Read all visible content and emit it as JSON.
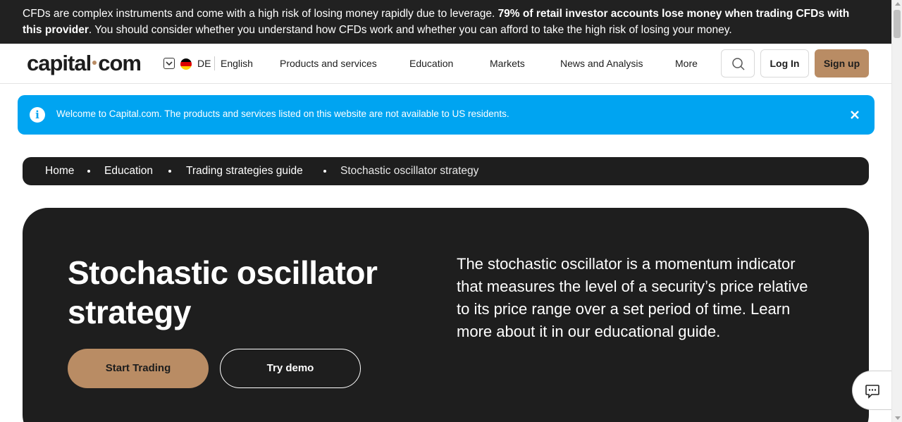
{
  "risk_warning": {
    "text_before": "CFDs are complex instruments and come with a high risk of losing money rapidly due to leverage. ",
    "bold_text": "79% of retail investor accounts lose money when trading CFDs with this provider",
    "text_after": ". You should consider whether you understand how CFDs work and whether you can afford to take the high risk of losing your money."
  },
  "header": {
    "logo_left": "capital",
    "logo_right": "com",
    "lang_code": "DE",
    "lang_name": "English",
    "flag_colors": [
      "#000000",
      "#dd0000",
      "#ffce00"
    ],
    "nav": [
      {
        "label": "Products and services"
      },
      {
        "label": "Education"
      },
      {
        "label": "Markets"
      },
      {
        "label": "News and Analysis"
      },
      {
        "label": "More"
      }
    ],
    "login_label": "Log In",
    "signup_label": "Sign up"
  },
  "notice": {
    "icon": "info-icon",
    "text": "Welcome to Capital.com. The products and services listed on this website are not available to US residents.",
    "close_icon": "close-icon"
  },
  "breadcrumb": [
    {
      "label": "Home"
    },
    {
      "label": "Education"
    },
    {
      "label": "Trading strategies guide"
    },
    {
      "label": "Stochastic oscillator strategy"
    }
  ],
  "hero": {
    "title": "Stochastic oscillator strategy",
    "description": "The stochastic oscillator is a momentum indicator that measures the level of a security’s price relative to its price range over a set period of time. Learn more about it in our educational guide.",
    "start_trading_label": "Start Trading",
    "try_demo_label": "Try demo"
  },
  "colors": {
    "accent": "#b98c64",
    "dark": "#1e1e1e",
    "notice_blue": "#00a4f1"
  }
}
